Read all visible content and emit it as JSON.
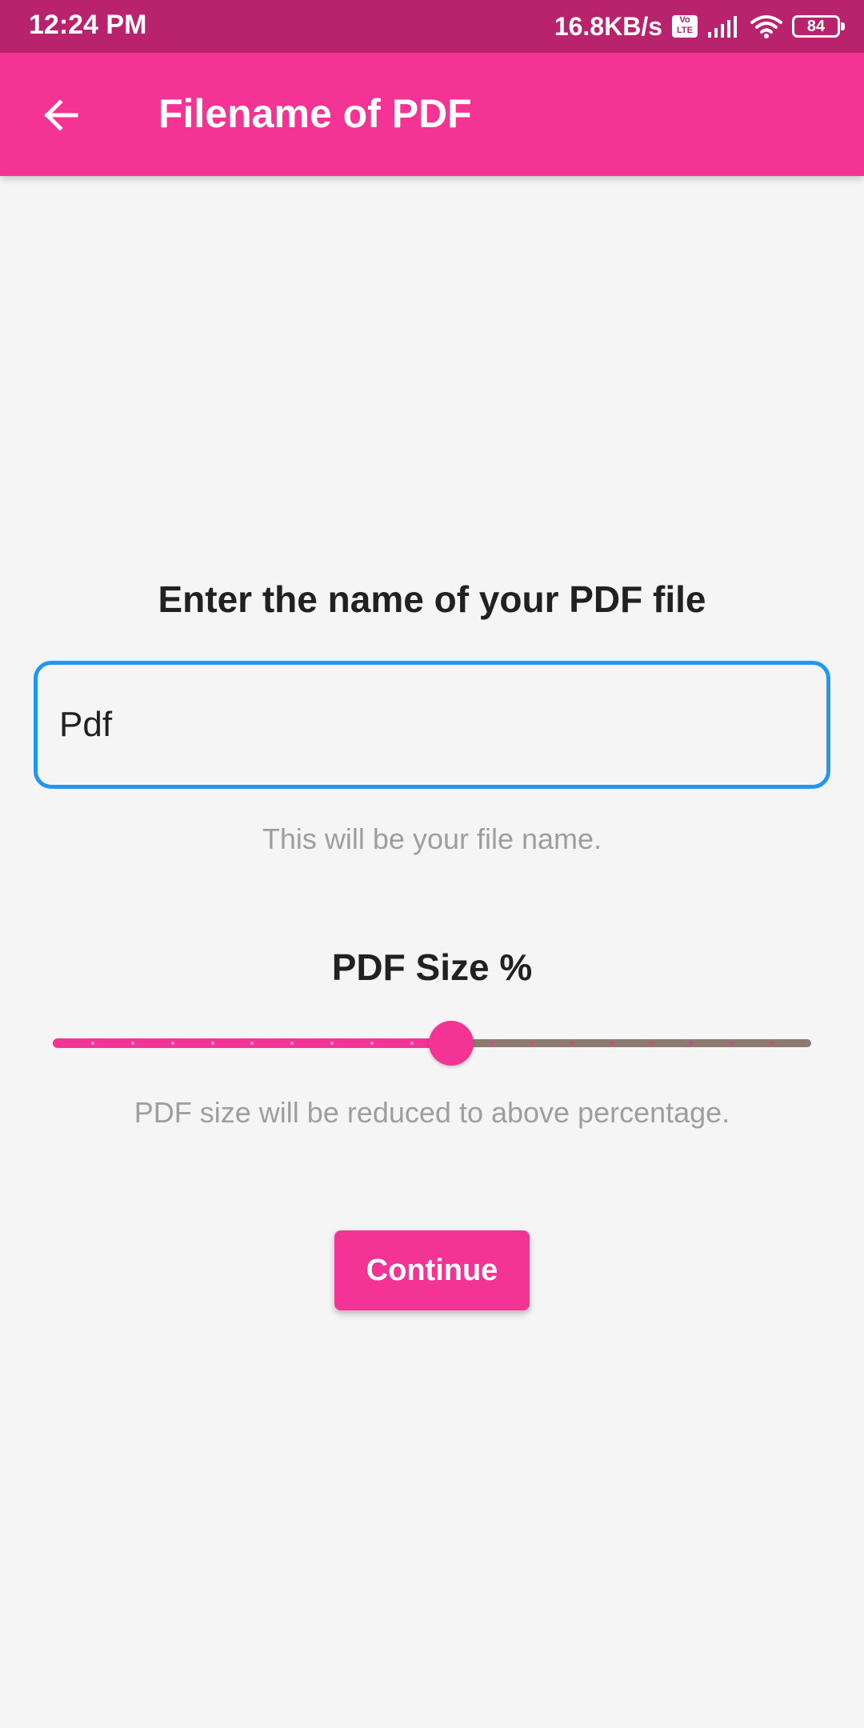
{
  "status_bar": {
    "time": "12:24 PM",
    "network_speed": "16.8KB/s",
    "volte_label": "Vo LTE",
    "battery_level": "84",
    "icons": [
      "volte-icon",
      "signal-icon",
      "wifi-icon",
      "battery-icon"
    ]
  },
  "app_bar": {
    "title": "Filename of PDF",
    "back_icon": "arrow-left-icon"
  },
  "filename": {
    "label": "Enter the name of your PDF file",
    "value": "Pdf",
    "helper": "This will be your file name."
  },
  "pdf_size": {
    "label": "PDF Size %",
    "value_fraction": 0.525,
    "divisions": 19,
    "helper": "PDF size will be reduced to above percentage."
  },
  "actions": {
    "continue_label": "Continue"
  },
  "colors": {
    "status_bar": "#b9236d",
    "primary": "#f33494",
    "input_focus": "#2196f3",
    "slider_inactive": "#8c7a70",
    "background": "#f5f5f5"
  }
}
